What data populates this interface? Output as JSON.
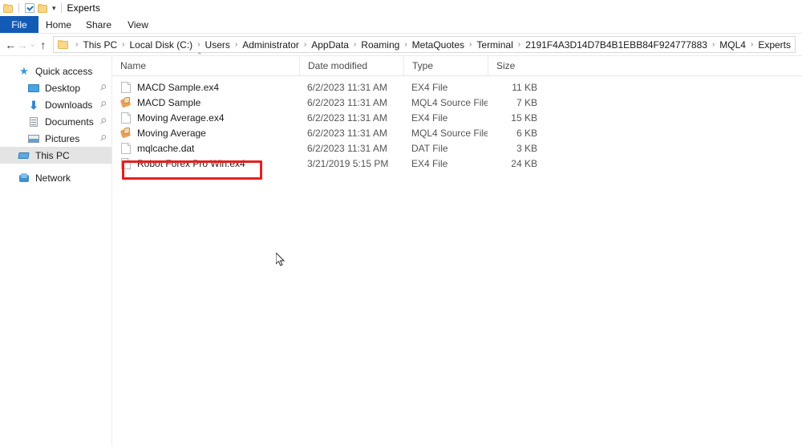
{
  "window": {
    "title": "Experts",
    "quick_access": [
      {
        "name": "folder-icon",
        "label": "Explorer"
      },
      {
        "name": "properties-icon",
        "label": "Properties"
      },
      {
        "name": "new-folder-icon",
        "label": "New folder"
      }
    ],
    "customize_caret": "▾"
  },
  "ribbon": {
    "tabs": [
      {
        "label": "File",
        "active": true
      },
      {
        "label": "Home",
        "active": false
      },
      {
        "label": "Share",
        "active": false
      },
      {
        "label": "View",
        "active": false
      }
    ]
  },
  "navigation": {
    "back": "←",
    "forward": "→",
    "recent": "⌄",
    "up": "↑",
    "breadcrumbs": [
      "This PC",
      "Local Disk (C:)",
      "Users",
      "Administrator",
      "AppData",
      "Roaming",
      "MetaQuotes",
      "Terminal",
      "2191F4A3D14D7B4B1EBB84F924777883",
      "MQL4",
      "Experts"
    ],
    "separator": "›"
  },
  "sidebar": {
    "items": [
      {
        "label": "Quick access",
        "icon": "star-icon",
        "indent": 0,
        "pinned": false,
        "selected": false
      },
      {
        "label": "Desktop",
        "icon": "desktop-icon",
        "indent": 1,
        "pinned": true,
        "selected": false
      },
      {
        "label": "Downloads",
        "icon": "downloads-icon",
        "indent": 1,
        "pinned": true,
        "selected": false
      },
      {
        "label": "Documents",
        "icon": "documents-icon",
        "indent": 1,
        "pinned": true,
        "selected": false
      },
      {
        "label": "Pictures",
        "icon": "pictures-icon",
        "indent": 1,
        "pinned": true,
        "selected": false
      },
      {
        "label": "This PC",
        "icon": "this-pc-icon",
        "indent": 0,
        "pinned": false,
        "selected": true
      },
      {
        "label": "Network",
        "icon": "network-icon",
        "indent": 0,
        "pinned": false,
        "selected": false
      }
    ],
    "pin_glyph": "📌"
  },
  "file_list": {
    "columns": [
      {
        "label": "Name",
        "sorted": "asc",
        "sort_glyph": "⌃"
      },
      {
        "label": "Date modified",
        "sorted": "none"
      },
      {
        "label": "Type",
        "sorted": "none"
      },
      {
        "label": "Size",
        "sorted": "none"
      }
    ],
    "rows": [
      {
        "name": "MACD Sample.ex4",
        "date": "6/2/2023 11:31 AM",
        "type": "EX4 File",
        "size": "11 KB",
        "icon": "file-page-icon",
        "highlighted": false
      },
      {
        "name": "MACD Sample",
        "date": "6/2/2023 11:31 AM",
        "type": "MQL4 Source File",
        "size": "7 KB",
        "icon": "mql4-source-icon",
        "highlighted": false
      },
      {
        "name": "Moving Average.ex4",
        "date": "6/2/2023 11:31 AM",
        "type": "EX4 File",
        "size": "15 KB",
        "icon": "file-page-icon",
        "highlighted": false
      },
      {
        "name": "Moving Average",
        "date": "6/2/2023 11:31 AM",
        "type": "MQL4 Source File",
        "size": "6 KB",
        "icon": "mql4-source-icon",
        "highlighted": false
      },
      {
        "name": "mqlcache.dat",
        "date": "6/2/2023 11:31 AM",
        "type": "DAT File",
        "size": "3 KB",
        "icon": "file-page-icon",
        "highlighted": false
      },
      {
        "name": "Robot Forex Pro Win.ex4",
        "date": "3/21/2019 5:15 PM",
        "type": "EX4 File",
        "size": "24 KB",
        "icon": "file-page-icon",
        "highlighted": true
      }
    ]
  },
  "annotation": {
    "color": "#e81e1e",
    "target_row_index": 5
  }
}
